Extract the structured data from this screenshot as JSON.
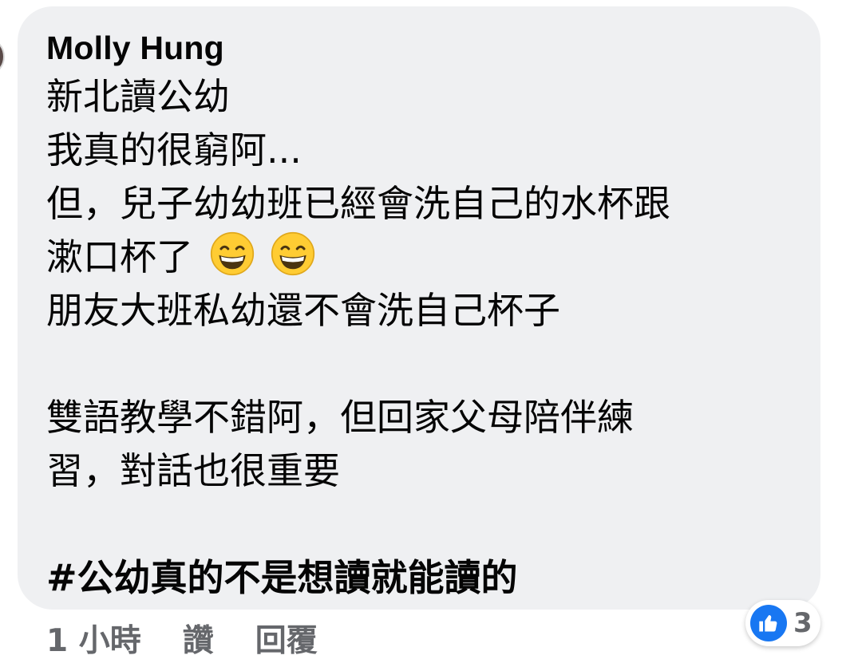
{
  "comment": {
    "author": "Molly Hung",
    "lines": [
      "新北讀公幼",
      "我真的很窮阿...",
      "但，兒子幼幼班已經會洗自己的水杯跟",
      "漱口杯了",
      "朋友大班私幼還不會洗自己杯子",
      "",
      "雙語教學不錯阿，但回家父母陪伴練",
      "習，對話也很重要",
      "",
      "#公幼真的不是想讀就能讀的"
    ],
    "emojis": [
      "grinning-face-with-smiling-eyes",
      "grinning-face-with-smiling-eyes"
    ]
  },
  "actions": {
    "time": "1 小時",
    "like_label": "讚",
    "reply_label": "回覆"
  },
  "reactions": {
    "icon": "thumbs-up-icon",
    "count": "3",
    "color": "#1877f2"
  },
  "colors": {
    "bubble_bg": "#eff0f2",
    "text": "#050505",
    "secondary_text": "#65676b"
  }
}
